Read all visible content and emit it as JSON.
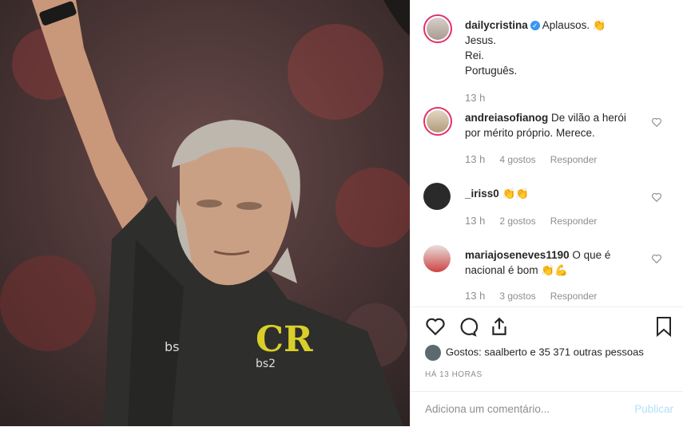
{
  "post": {
    "author": "dailycristina",
    "caption_lines": [
      "Aplausos. 👏",
      "Jesus.",
      "Rei.",
      "Português."
    ],
    "caption_time": "13 h"
  },
  "comments": [
    {
      "user": "andreiasofianog",
      "text": "De vilão a herói por mérito próprio. Merece.",
      "time": "13 h",
      "likes": "4 gostos",
      "reply": "Responder"
    },
    {
      "user": "_iriss0",
      "text": "👏👏",
      "time": "13 h",
      "likes": "2 gostos",
      "reply": "Responder"
    },
    {
      "user": "mariajoseneves1190",
      "text": "O que é nacional é bom 👏💪",
      "time": "13 h",
      "likes": "3 gostos",
      "reply": "Responder"
    }
  ],
  "likes_text": "Gostos: saalberto e 35 371 outras pessoas",
  "posted_ago": "HÁ 13 HORAS",
  "comment_placeholder": "Adiciona um comentário...",
  "publish_label": "Publicar",
  "colors": {
    "link_blue": "#3897f0",
    "disabled_blue": "#b2dffc",
    "meta_gray": "#8e8e8e",
    "ring": "#e1306c"
  }
}
